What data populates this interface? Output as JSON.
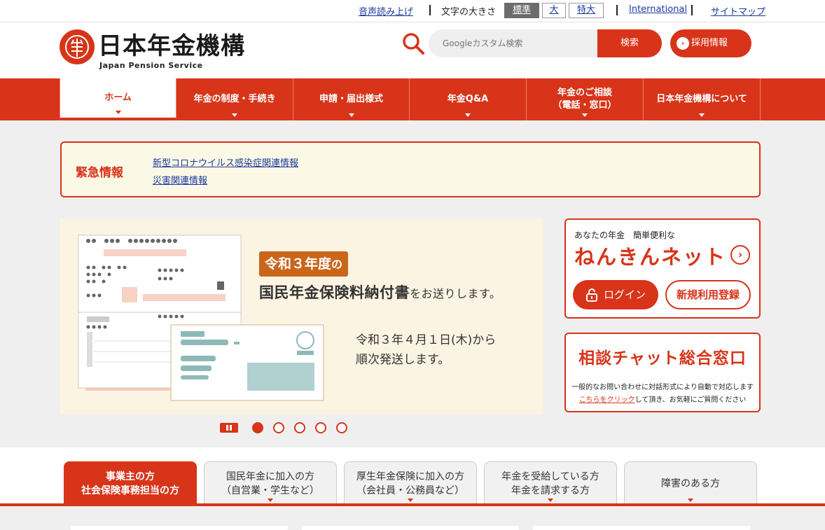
{
  "topbar": {
    "voice_read": "音声読み上げ",
    "font_size_label": "文字の大きさ",
    "font_sizes": [
      "標準",
      "大",
      "特大"
    ],
    "international": "International",
    "sitemap": "サイトマップ"
  },
  "header": {
    "logo_title": "日本年金機構",
    "logo_sub": "Japan Pension Service",
    "search_placeholder": "Googleカスタム検索",
    "search_button": "検索",
    "recruit_button": "採用情報"
  },
  "nav": {
    "items": [
      {
        "label": "ホーム"
      },
      {
        "label": "年金の制度・手続き"
      },
      {
        "label": "申請・届出様式"
      },
      {
        "label": "年金Q&A"
      },
      {
        "label": "年金のご相談",
        "label2": "（電話・窓口）"
      },
      {
        "label": "日本年金機構について"
      }
    ]
  },
  "emergency": {
    "title": "緊急情報",
    "links": [
      "新型コロナウイルス感染症関連情報",
      "災害関連情報"
    ]
  },
  "banner": {
    "tag_year": "令和３年度",
    "tag_no": "の",
    "main_bold": "国民年金保険料納付書",
    "main_rest": "をお送りします。",
    "sub_line1": "令和３年４月１日(木)から",
    "sub_line2": "順次発送します。"
  },
  "carousel": {
    "slide_count": 5,
    "active_slide": 1
  },
  "nenkin_net": {
    "small": "あなたの年金　簡単便利な",
    "big": "ねんきんネット",
    "login": "ログイン",
    "register": "新規利用登録"
  },
  "chat": {
    "title": "相談チャット総合窓口",
    "line1": "一般的なお問い合わせに対話形式により自動で対応します",
    "link": "こちらをクリック",
    "line2_rest": "して頂き、お気軽にご質問ください"
  },
  "user_tabs": [
    {
      "line1": "事業主の方",
      "line2": "社会保険事務担当の方"
    },
    {
      "line1": "国民年金に加入の方",
      "line2": "（自営業・学生など）"
    },
    {
      "line1": "厚生年金保険に加入の方",
      "line2": "（会社員・公務員など）"
    },
    {
      "line1": "年金を受給している方",
      "line2": "年金を請求する方"
    },
    {
      "line1": "障害のある方",
      "line2": ""
    }
  ],
  "colors": {
    "brand": "#d73419",
    "link": "#1a3a9c",
    "emergency_bg": "#fcf8e6"
  }
}
